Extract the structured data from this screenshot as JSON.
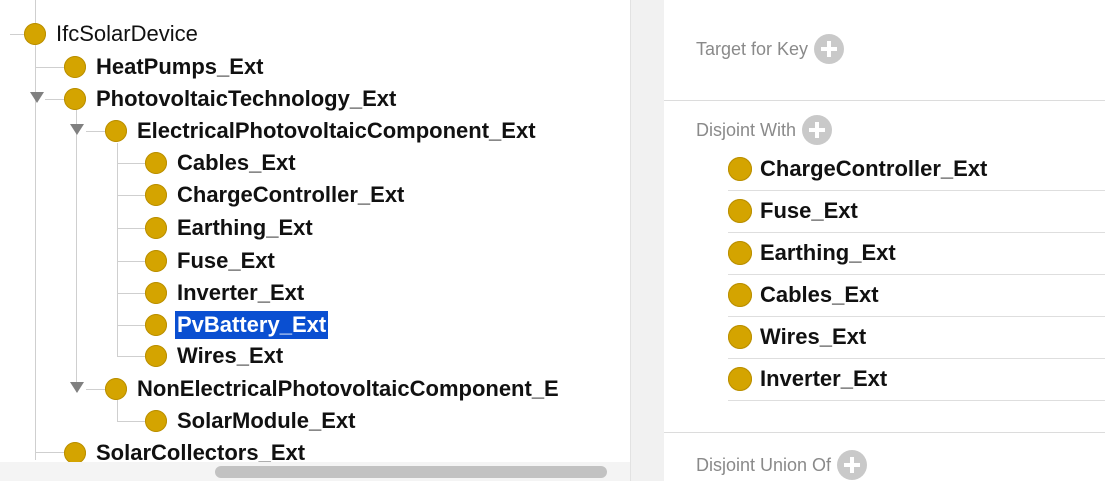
{
  "tree": {
    "root": "IfcSolarDevice",
    "heatpumps": "HeatPumps_Ext",
    "photovoltaic": "PhotovoltaicTechnology_Ext",
    "electrical": "ElectricalPhotovoltaicComponent_Ext",
    "cables": "Cables_Ext",
    "chargecontroller": "ChargeController_Ext",
    "earthing": "Earthing_Ext",
    "fuse": "Fuse_Ext",
    "inverter": "Inverter_Ext",
    "pvbattery": "PvBattery_Ext",
    "wires": "Wires_Ext",
    "nonelectrical": "NonElectricalPhotovoltaicComponent_E",
    "solarmodule": "SolarModule_Ext",
    "solarcollectors": "SolarCollectors_Ext"
  },
  "description": {
    "target_for_key": "Target for Key",
    "disjoint_with": "Disjoint With",
    "disjoint_items": [
      "ChargeController_Ext",
      "Fuse_Ext",
      "Earthing_Ext",
      "Cables_Ext",
      "Wires_Ext",
      "Inverter_Ext"
    ],
    "disjoint_union_of": "Disjoint Union Of"
  },
  "colors": {
    "class_dot": "#d4a400",
    "selection": "#0a4fd1"
  }
}
